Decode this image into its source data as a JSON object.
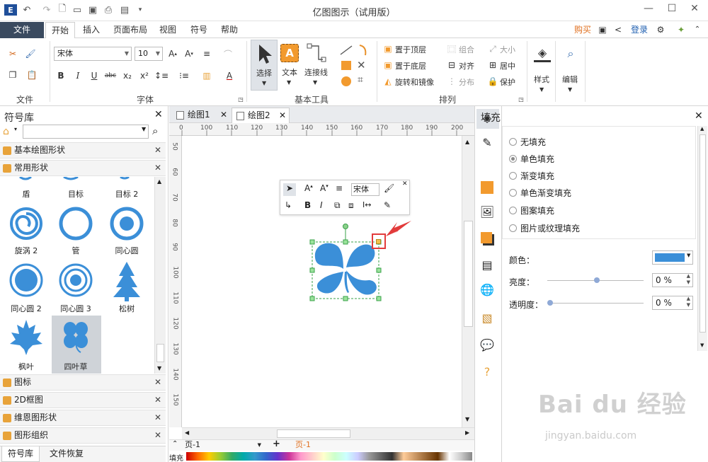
{
  "app": {
    "title": "亿图图示（试用版）"
  },
  "titlebar": {
    "logo": "E",
    "minimize": "—",
    "maximize": "☐",
    "close": "✕"
  },
  "menu": {
    "file": "文件",
    "tabs": [
      "开始",
      "插入",
      "页面布局",
      "视图",
      "符号",
      "帮助"
    ],
    "buy": "购买",
    "login": "登录"
  },
  "ribbon": {
    "groups": {
      "file": "文件",
      "font": "字体",
      "basic_tools": "基本工具",
      "arrange": "排列"
    },
    "font_name": "宋体",
    "font_size": "10",
    "bold": "B",
    "italic": "I",
    "underline": "U",
    "strike": "abc",
    "sub": "x₂",
    "sup": "x²",
    "tools": {
      "select": "选择",
      "text": "文本",
      "connector": "连接线"
    },
    "arrange": {
      "bring_top": "置于顶层",
      "bring_bottom": "置于底层",
      "rotate": "旋转和镜像",
      "group": "组合",
      "align": "对齐",
      "distribute": "分布",
      "size": "大小",
      "center": "居中",
      "protect": "保护"
    },
    "style": "样式",
    "edit": "编辑",
    "text_icon": "A"
  },
  "library": {
    "title": "符号库",
    "search_placeholder": "",
    "categories_top": [
      "基本绘图形状",
      "常用形状"
    ],
    "shapes_row0": [
      "盾",
      "目标",
      "目标 2"
    ],
    "shapes_row1": [
      "旋涡 2",
      "管",
      "同心圆"
    ],
    "shapes_row2": [
      "同心圆 2",
      "同心圆 3",
      "松树"
    ],
    "shapes_row3": [
      "枫叶",
      "四叶草"
    ],
    "categories_bottom": [
      "图标",
      "2D框图",
      "维恩图形状",
      "图形组织"
    ],
    "bottom_tabs": [
      "符号库",
      "文件恢复"
    ]
  },
  "doc_tabs": [
    "绘图1",
    "绘图2"
  ],
  "ruler": {
    "h": [
      "0",
      "100",
      "110",
      "120",
      "130",
      "140",
      "150",
      "160",
      "170",
      "180",
      "190",
      "200"
    ],
    "v": [
      "50",
      "60",
      "70",
      "80",
      "90",
      "100",
      "110",
      "120",
      "130",
      "140",
      "150"
    ]
  },
  "float_toolbar": {
    "font": "宋体"
  },
  "page_bar": {
    "page_select": "页-1",
    "add": "+",
    "current": "页-1",
    "fill_label": "填充"
  },
  "fill_panel": {
    "title": "填充",
    "options": [
      "无填充",
      "单色填充",
      "渐变填充",
      "单色渐变填充",
      "图案填充",
      "图片或纹理填充"
    ],
    "selected_index": 1,
    "color_label": "颜色：",
    "color_value": "#3b8fd8",
    "brightness_label": "亮度：",
    "brightness_value": "0 %",
    "transparency_label": "透明度：",
    "transparency_value": "0 %"
  },
  "colors": {
    "accent": "#3b8fd8",
    "selection": "#3aa14a",
    "highlight": "#e23b3b",
    "orange": "#f29a2e"
  },
  "watermark": {
    "main": "Bai du 经验",
    "sub": "jingyan.baidu.com"
  }
}
